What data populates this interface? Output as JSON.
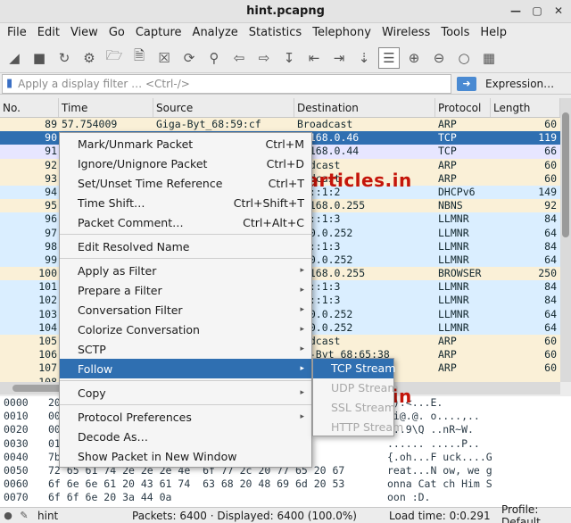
{
  "window": {
    "title": "hint.pcapng"
  },
  "menu": [
    "File",
    "Edit",
    "View",
    "Go",
    "Capture",
    "Analyze",
    "Statistics",
    "Telephony",
    "Wireless",
    "Tools",
    "Help"
  ],
  "filter": {
    "placeholder": "Apply a display filter … <Ctrl-/>",
    "expression_label": "Expression…"
  },
  "columns": {
    "no": "No.",
    "time": "Time",
    "source": "Source",
    "destination": "Destination",
    "protocol": "Protocol",
    "length": "Length"
  },
  "packets": [
    {
      "no": "89",
      "time": "57.754009",
      "source": "Giga-Byt_68:59:cf",
      "destination": "Broadcast",
      "protocol": "ARP",
      "length": "60",
      "kind": "arp"
    },
    {
      "no": "90",
      "time": "",
      "source": "",
      "destination": "2.168.0.46",
      "protocol": "TCP",
      "length": "119",
      "kind": "sel"
    },
    {
      "no": "91",
      "time": "",
      "source": "",
      "destination": "2.168.0.44",
      "protocol": "TCP",
      "length": "66",
      "kind": "tcp"
    },
    {
      "no": "92",
      "time": "",
      "source": "",
      "destination": "oadcast",
      "protocol": "ARP",
      "length": "60",
      "kind": "arp"
    },
    {
      "no": "93",
      "time": "",
      "source": "",
      "destination": "oadcast",
      "protocol": "ARP",
      "length": "60",
      "kind": "arp"
    },
    {
      "no": "94",
      "time": "",
      "source": "",
      "destination": "02::1:2",
      "protocol": "DHCPv6",
      "length": "149",
      "kind": "udp"
    },
    {
      "no": "95",
      "time": "",
      "source": "",
      "destination": "2.168.0.255",
      "protocol": "NBNS",
      "length": "92",
      "kind": "arp"
    },
    {
      "no": "96",
      "time": "",
      "source": "",
      "destination": "02::1:3",
      "protocol": "LLMNR",
      "length": "84",
      "kind": "udp"
    },
    {
      "no": "97",
      "time": "",
      "source": "",
      "destination": "4.0.0.252",
      "protocol": "LLMNR",
      "length": "64",
      "kind": "udp"
    },
    {
      "no": "98",
      "time": "",
      "source": "",
      "destination": "02::1:3",
      "protocol": "LLMNR",
      "length": "84",
      "kind": "udp"
    },
    {
      "no": "99",
      "time": "",
      "source": "",
      "destination": "4.0.0.252",
      "protocol": "LLMNR",
      "length": "64",
      "kind": "udp"
    },
    {
      "no": "100",
      "time": "",
      "source": "",
      "destination": "2.168.0.255",
      "protocol": "BROWSER",
      "length": "250",
      "kind": "arp"
    },
    {
      "no": "101",
      "time": "",
      "source": "",
      "destination": "02::1:3",
      "protocol": "LLMNR",
      "length": "84",
      "kind": "udp"
    },
    {
      "no": "102",
      "time": "",
      "source": "",
      "destination": "02::1:3",
      "protocol": "LLMNR",
      "length": "84",
      "kind": "udp"
    },
    {
      "no": "103",
      "time": "",
      "source": "",
      "destination": "4.0.0.252",
      "protocol": "LLMNR",
      "length": "64",
      "kind": "udp"
    },
    {
      "no": "104",
      "time": "",
      "source": "",
      "destination": "4.0.0.252",
      "protocol": "LLMNR",
      "length": "64",
      "kind": "udp"
    },
    {
      "no": "105",
      "time": "",
      "source": "",
      "destination": "oadcast",
      "protocol": "ARP",
      "length": "60",
      "kind": "arp"
    },
    {
      "no": "106",
      "time": "",
      "source": "",
      "destination": "ga-Byt_68:65:38",
      "protocol": "ARP",
      "length": "60",
      "kind": "arp"
    },
    {
      "no": "107",
      "time": "",
      "source": "",
      "destination": "oadcast",
      "protocol": "ARP",
      "length": "60",
      "kind": "arp"
    },
    {
      "no": "108",
      "time": "",
      "source": "",
      "destination": "",
      "protocol": "",
      "length": "",
      "kind": "arp"
    }
  ],
  "hex": [
    {
      "off": "0000",
      "bytes": "20",
      "ascii": " ).<...E."
    },
    {
      "off": "0010",
      "bytes": "00",
      "ascii": ".i@.@. o....,.."
    },
    {
      "off": "0020",
      "bytes": "00",
      "ascii": "...9\\Q ..nR~W."
    },
    {
      "off": "0030",
      "bytes": "01                              50 00 0c",
      "ascii": "...... .....P.."
    },
    {
      "off": "0040",
      "bytes": "7b                              20 2e 47",
      "ascii": "{.oh...F uck....G"
    },
    {
      "off": "0050",
      "bytes": "72 65 61 74 2e 2e 2e 4e  6f 77 2c 20 77 65 20 67",
      "ascii": "reat...N ow, we g"
    },
    {
      "off": "0060",
      "bytes": "6f 6e 6e 61 20 43 61 74  63 68 20 48 69 6d 20 53",
      "ascii": "onna Cat ch Him S"
    },
    {
      "off": "0070",
      "bytes": "6f 6f 6e 20 3a 44 0a",
      "ascii": "oon :D."
    }
  ],
  "context_menu": [
    {
      "label": "Mark/Unmark Packet",
      "shortcut": "Ctrl+M"
    },
    {
      "label": "Ignore/Unignore Packet",
      "shortcut": "Ctrl+D"
    },
    {
      "label": "Set/Unset Time Reference",
      "shortcut": "Ctrl+T"
    },
    {
      "label": "Time Shift…",
      "shortcut": "Ctrl+Shift+T"
    },
    {
      "label": "Packet Comment…",
      "shortcut": "Ctrl+Alt+C"
    },
    {
      "sep": true
    },
    {
      "label": "Edit Resolved Name"
    },
    {
      "sep": true
    },
    {
      "label": "Apply as Filter",
      "arrow": true
    },
    {
      "label": "Prepare a Filter",
      "arrow": true
    },
    {
      "label": "Conversation Filter",
      "arrow": true
    },
    {
      "label": "Colorize Conversation",
      "arrow": true
    },
    {
      "label": "SCTP",
      "arrow": true
    },
    {
      "label": "Follow",
      "arrow": true,
      "highlight": true
    },
    {
      "sep": true
    },
    {
      "label": "Copy",
      "arrow": true
    },
    {
      "sep": true
    },
    {
      "label": "Protocol Preferences",
      "arrow": true
    },
    {
      "label": "Decode As…"
    },
    {
      "label": "Show Packet in New Window"
    }
  ],
  "follow_submenu": [
    {
      "label": "TCP Stream",
      "highlight": true
    },
    {
      "label": "UDP Stream"
    },
    {
      "label": "SSL Stream"
    },
    {
      "label": "HTTP Stream"
    }
  ],
  "status": {
    "file": "hint",
    "packets": "Packets: 6400 · Displayed: 6400 (100.0%)",
    "load_time": "Load time: 0:0.291",
    "profile": "Profile: Default"
  },
  "watermark": "www.hackingarticles.in",
  "colors": {
    "selection": "#2f6fb1",
    "arp_row": "#faf0d7",
    "tcp_row": "#e7e6ff",
    "udp_row": "#daeeff",
    "watermark": "#c4150a"
  }
}
